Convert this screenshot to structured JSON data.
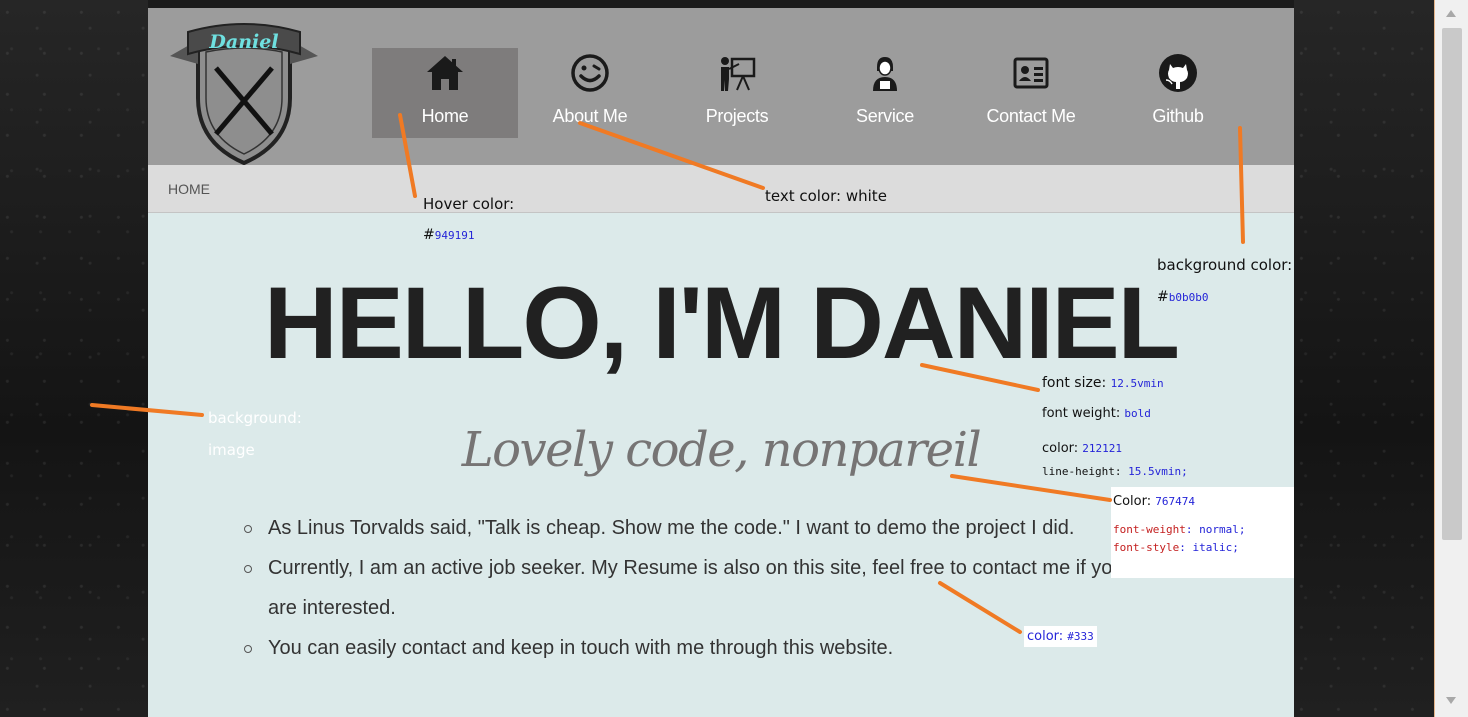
{
  "logo": {
    "name": "Daniel"
  },
  "nav": {
    "items": [
      {
        "label": "Home",
        "icon": "home-icon",
        "active": true
      },
      {
        "label": "About Me",
        "icon": "smiley-icon",
        "active": false
      },
      {
        "label": "Projects",
        "icon": "presentation-icon",
        "active": false
      },
      {
        "label": "Service",
        "icon": "person-icon",
        "active": false
      },
      {
        "label": "Contact Me",
        "icon": "contact-card-icon",
        "active": false
      },
      {
        "label": "Github",
        "icon": "github-icon",
        "active": false
      }
    ]
  },
  "breadcrumb": "HOME",
  "hero": {
    "title": "HELLO, I'M DANIEL",
    "subtitle": "Lovely code, nonpareil"
  },
  "bullets": [
    "As Linus Torvalds said, \"Talk is cheap. Show me the code.\" I want to demo the project I did.",
    "Currently, I am an active job seeker. My Resume is also on this site, feel free to contact me if you are interested.",
    "You can easily contact and keep in touch with me through this website."
  ],
  "annotations": {
    "hover_label": "Hover color:",
    "hover_hash": "#",
    "hover_value": "949191",
    "text_color": "text color: white",
    "bg_color_label": "background color:",
    "bg_color_hash": "#",
    "bg_color_value": "b0b0b0",
    "background_label": "background:",
    "background_value": "image",
    "font_size_label": "font size: ",
    "font_size_value": "12.5vmin",
    "font_weight_label": "font weight: ",
    "font_weight_value": "bold",
    "title_color_label": "color: ",
    "title_color_value": "212121",
    "line_height_label": "line-height: ",
    "line_height_value": "15.5vmin;",
    "sub_color_label": "Color: ",
    "sub_color_value": "767474",
    "sub_weight_prop": "font-weight",
    "sub_weight_value": ": normal;",
    "sub_style_prop": "font-style",
    "sub_style_value": ": italic;",
    "bullet_color_label": "color: ",
    "bullet_color_value": "#333"
  },
  "colors": {
    "nav_bg": "#9c9c9c",
    "hover": "#949191",
    "page_bg": "#dceaea",
    "title": "#212121",
    "subtitle": "#767474",
    "text": "#333333",
    "annotation_arrow": "#f07a24"
  }
}
